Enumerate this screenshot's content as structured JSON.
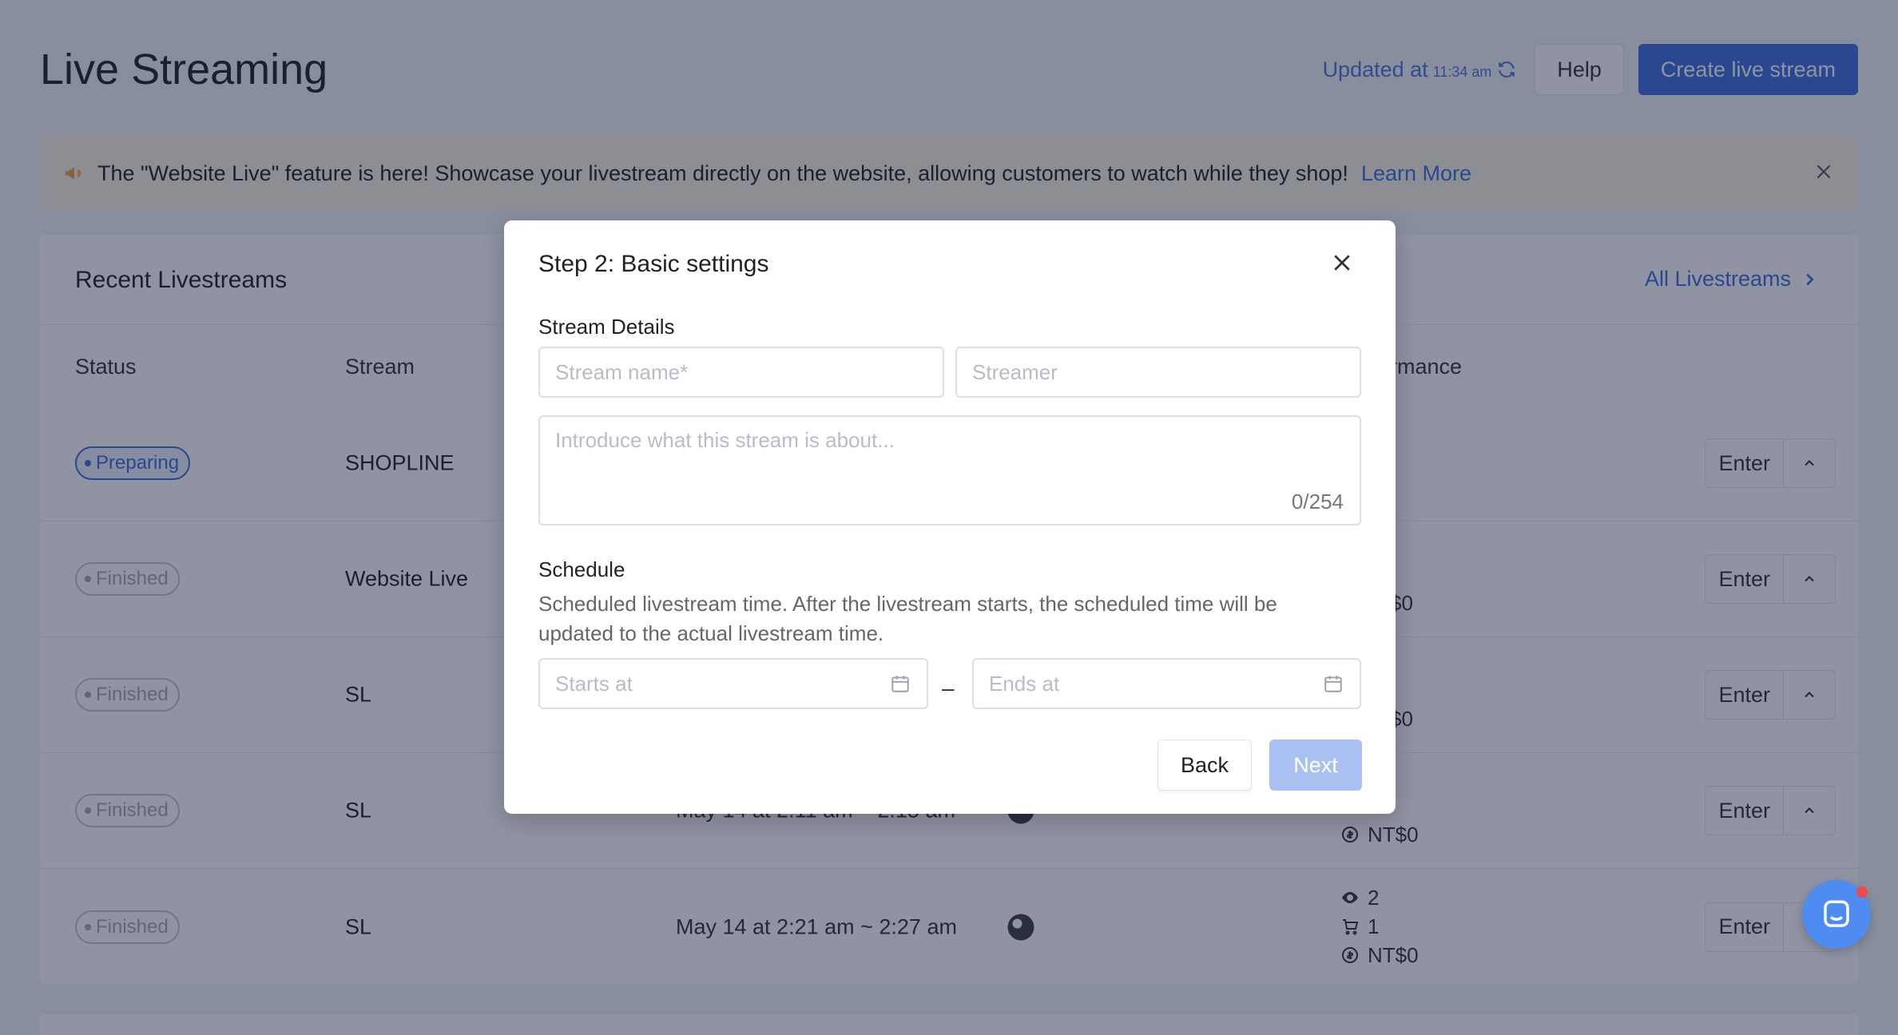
{
  "header": {
    "title": "Live Streaming",
    "updated_label": "Updated at",
    "updated_time": "11:34 am",
    "help_label": "Help",
    "create_label": "Create live stream"
  },
  "announcement": {
    "text": "The \"Website Live\" feature is here! Showcase your livestream directly on the website, allowing customers to watch while they shop!",
    "link": "Learn More"
  },
  "panel": {
    "title": "Recent Livestreams",
    "all_link": "All Livestreams",
    "columns": {
      "status": "Status",
      "stream": "Stream",
      "performance": "rmance"
    },
    "enter_label": "Enter",
    "rows": [
      {
        "status": "Preparing",
        "name": "SHOPLINE",
        "time": "",
        "perf_views": "",
        "perf_carts": "",
        "perf_revenue": ""
      },
      {
        "status": "Finished",
        "name": "Website Live",
        "time": "",
        "perf_views": "",
        "perf_carts": "",
        "perf_revenue": "$0"
      },
      {
        "status": "Finished",
        "name": "SL",
        "time": "",
        "perf_views": "",
        "perf_carts": "",
        "perf_revenue": "$0"
      },
      {
        "status": "Finished",
        "name": "SL",
        "time": "May 14 at 2:11 am ~ 2:15 am",
        "perf_views": "",
        "perf_carts": "",
        "perf_revenue": "NT$0"
      },
      {
        "status": "Finished",
        "name": "SL",
        "time": "May 14 at 2:21 am ~ 2:27 am",
        "perf_views": "2",
        "perf_carts": "1",
        "perf_revenue": "NT$0"
      }
    ]
  },
  "modal": {
    "title": "Step 2: Basic settings",
    "stream_details_label": "Stream Details",
    "stream_name_placeholder": "Stream name*",
    "streamer_placeholder": "Streamer",
    "description_placeholder": "Introduce what this stream is about...",
    "counter": "0/254",
    "schedule_label": "Schedule",
    "schedule_help": "Scheduled livestream time. After the livestream starts, the scheduled time will be updated to the actual livestream time.",
    "starts_placeholder": "Starts at",
    "ends_placeholder": "Ends at",
    "range_separator": "–",
    "back_label": "Back",
    "next_label": "Next"
  },
  "colors": {
    "accent": "#3c6fdb",
    "next_disabled": "#a9c1f2",
    "chat": "#4e8cf1"
  }
}
